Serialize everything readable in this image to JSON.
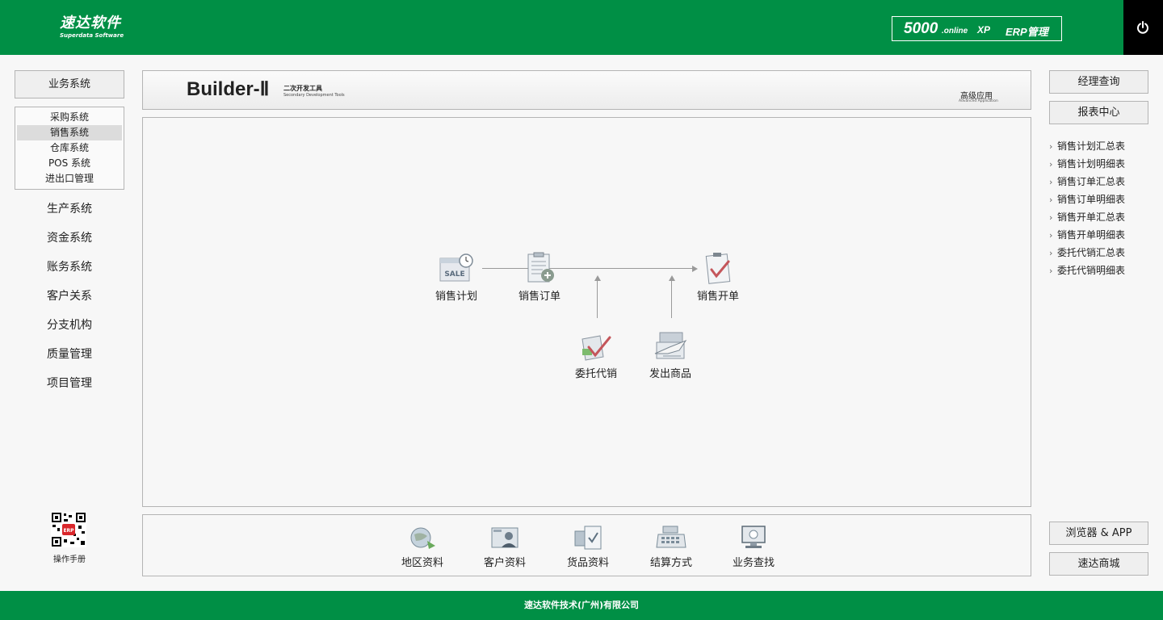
{
  "header": {
    "logo_cn": "速达软件",
    "logo_en": "Superdata Software",
    "product_version": "5000",
    "product_online": ".online",
    "product_xp": "XP",
    "product_erp": "ERP管理",
    "power_icon": "power-icon"
  },
  "left_nav": {
    "main_label": "业务系统",
    "sub_items": [
      "采购系统",
      "销售系统",
      "仓库系统",
      "POS 系统",
      "进出口管理"
    ],
    "active_sub": "销售系统",
    "items": [
      "生产系统",
      "资金系统",
      "账务系统",
      "客户关系",
      "分支机构",
      "质量管理",
      "项目管理"
    ],
    "qr_label": "操作手册"
  },
  "banner": {
    "title": "Builder-Ⅱ",
    "subtitle_cn": "二次开发工具",
    "subtitle_en": "Secondary Development Tools",
    "advanced_cn": "高级应用",
    "advanced_en": "Advanced Application"
  },
  "flow": {
    "sales_plan": "销售计划",
    "sales_order": "销售订单",
    "sales_invoice": "销售开单",
    "consignment": "委托代销",
    "ship_goods": "发出商品",
    "sale_icon_text": "SALE"
  },
  "tools": [
    "地区资料",
    "客户资料",
    "货品资料",
    "结算方式",
    "业务查找"
  ],
  "right": {
    "manager_query": "经理查询",
    "report_center": "报表中心",
    "reports": [
      "销售计划汇总表",
      "销售计划明细表",
      "销售订单汇总表",
      "销售订单明细表",
      "销售开单汇总表",
      "销售开单明细表",
      "委托代销汇总表",
      "委托代销明细表"
    ],
    "browser_app": "浏览器 & APP",
    "shop": "速达商城"
  },
  "footer": {
    "company": "速达软件技术(广州)有限公司"
  },
  "colors": {
    "brand_green": "#008f45",
    "power_bg": "#000000"
  }
}
